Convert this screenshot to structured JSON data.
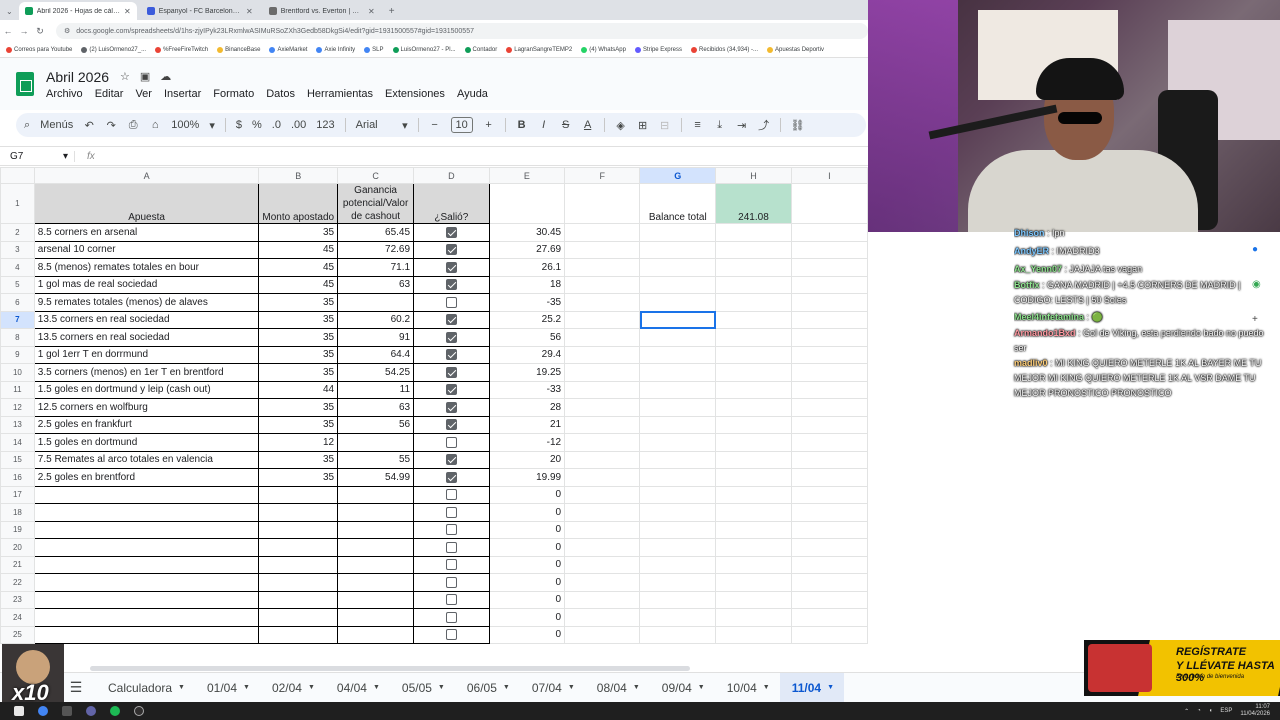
{
  "browser": {
    "tabs": [
      {
        "title": "Abril 2026 - Hojas de cálculo d",
        "active": true,
        "color": "#0f9d58"
      },
      {
        "title": "Espanyol - FC Barcelona en vivo",
        "active": false,
        "color": "#3b5bdb"
      },
      {
        "title": "Brentford vs. Everton | Disney+",
        "active": false,
        "color": "#6b6b6b"
      }
    ],
    "new_tab": "+",
    "url": "docs.google.com/spreadsheets/d/1hs-zjyIPyk23LRxmlwASIMuRSoZXh3Gedb58DkgSi4/edit?gid=1931500557#gid=1931500557",
    "bookmarks": [
      {
        "label": "Correos para Youtube",
        "color": "#ea4335"
      },
      {
        "label": "(2) LuisOrmeno27_...",
        "color": "#5f6368"
      },
      {
        "label": "%FreeFireTwitch",
        "color": "#ea4335"
      },
      {
        "label": "BinanceBase",
        "color": "#f3ba2f"
      },
      {
        "label": "AxieMarket",
        "color": "#4285f4"
      },
      {
        "label": "Axie Infinity",
        "color": "#4285f4"
      },
      {
        "label": "SLP",
        "color": "#4285f4"
      },
      {
        "label": "LuisOrmeno27 - Pl...",
        "color": "#0f9d58"
      },
      {
        "label": "Contador",
        "color": "#0f9d58"
      },
      {
        "label": "LagranSangreTEMP2",
        "color": "#ea4335"
      },
      {
        "label": "(4) WhatsApp",
        "color": "#25d366"
      },
      {
        "label": "Stripe Express",
        "color": "#635bff"
      },
      {
        "label": "Recibidos (34,934) -...",
        "color": "#ea4335"
      },
      {
        "label": "Apuestas Deportiv",
        "color": "#f3ba2f"
      }
    ]
  },
  "sheets_app": {
    "title": "Abril 2026",
    "menu": [
      "Archivo",
      "Editar",
      "Ver",
      "Insertar",
      "Formato",
      "Datos",
      "Herramientas",
      "Extensiones",
      "Ayuda"
    ],
    "toolbar": {
      "search": "Menús",
      "zoom": "100%",
      "currency": "$",
      "percent": "%",
      "dec_down": ".0",
      "dec_up": ".00",
      "format_123": "123",
      "font": "Arial",
      "font_size": "10"
    },
    "name_box": "G7",
    "fx": "fx"
  },
  "sheet": {
    "columns": [
      "A",
      "B",
      "C",
      "D",
      "E",
      "F",
      "G",
      "H",
      "I"
    ],
    "header_row": {
      "apuesta": "Apuesta",
      "monto": "Monto apostado",
      "ganancia": "Ganancia potencial/Valor de cashout",
      "salio": "¿Salió?",
      "balance_label": "Balance total",
      "balance_value": "241.08"
    },
    "rows": [
      {
        "n": "2",
        "apuesta": "8.5 corners en arsenal",
        "monto": "35",
        "ganancia": "65.45",
        "salio": true,
        "e": "30.45"
      },
      {
        "n": "3",
        "apuesta": "arsenal 10 corner",
        "monto": "45",
        "ganancia": "72.69",
        "salio": true,
        "e": "27.69"
      },
      {
        "n": "4",
        "apuesta": "8.5 (menos) remates totales en bour",
        "monto": "45",
        "ganancia": "71.1",
        "salio": true,
        "e": "26.1"
      },
      {
        "n": "5",
        "apuesta": "1 gol mas de real sociedad",
        "monto": "45",
        "ganancia": "63",
        "salio": true,
        "e": "18"
      },
      {
        "n": "6",
        "apuesta": "9.5 remates totales (menos) de alaves",
        "monto": "35",
        "ganancia": "",
        "salio": false,
        "e": "-35"
      },
      {
        "n": "7",
        "apuesta": "13.5 corners  en real sociedad",
        "monto": "35",
        "ganancia": "60.2",
        "salio": true,
        "e": "25.2"
      },
      {
        "n": "8",
        "apuesta": "13.5 corners  en real sociedad",
        "monto": "35",
        "ganancia": "91",
        "salio": true,
        "e": "56"
      },
      {
        "n": "9",
        "apuesta": "1 gol 1err T en dorrmund",
        "monto": "35",
        "ganancia": "64.4",
        "salio": true,
        "e": "29.4"
      },
      {
        "n": "10",
        "apuesta": "3.5 corners (menos) en 1er T en brentford",
        "monto": "35",
        "ganancia": "54.25",
        "salio": true,
        "e": "19.25"
      },
      {
        "n": "11",
        "apuesta": "1.5 goles en dortmund y leip (cash out)",
        "monto": "44",
        "ganancia": "11",
        "salio": true,
        "e": "-33"
      },
      {
        "n": "12",
        "apuesta": "12.5 corners en wolfburg",
        "monto": "35",
        "ganancia": "63",
        "salio": true,
        "e": "28"
      },
      {
        "n": "13",
        "apuesta": "2.5 goles en frankfurt",
        "monto": "35",
        "ganancia": "56",
        "salio": true,
        "e": "21"
      },
      {
        "n": "14",
        "apuesta": "1.5 goles en dortmund",
        "monto": "12",
        "ganancia": "",
        "salio": false,
        "e": "-12"
      },
      {
        "n": "15",
        "apuesta": "7.5 Remates al arco totales en valencia",
        "monto": "35",
        "ganancia": "55",
        "salio": true,
        "e": "20"
      },
      {
        "n": "16",
        "apuesta": "2.5 goles en brentford",
        "monto": "35",
        "ganancia": "54.99",
        "salio": true,
        "e": "19.99"
      },
      {
        "n": "17",
        "apuesta": "",
        "monto": "",
        "ganancia": "",
        "salio": false,
        "e": "0"
      },
      {
        "n": "18",
        "apuesta": "",
        "monto": "",
        "ganancia": "",
        "salio": false,
        "e": "0"
      },
      {
        "n": "19",
        "apuesta": "",
        "monto": "",
        "ganancia": "",
        "salio": false,
        "e": "0"
      },
      {
        "n": "20",
        "apuesta": "",
        "monto": "",
        "ganancia": "",
        "salio": false,
        "e": "0"
      },
      {
        "n": "21",
        "apuesta": "",
        "monto": "",
        "ganancia": "",
        "salio": false,
        "e": "0"
      },
      {
        "n": "22",
        "apuesta": "",
        "monto": "",
        "ganancia": "",
        "salio": false,
        "e": "0"
      },
      {
        "n": "23",
        "apuesta": "",
        "monto": "",
        "ganancia": "",
        "salio": false,
        "e": "0"
      },
      {
        "n": "24",
        "apuesta": "",
        "monto": "",
        "ganancia": "",
        "salio": false,
        "e": "0"
      },
      {
        "n": "25",
        "apuesta": "",
        "monto": "",
        "ganancia": "",
        "salio": false,
        "e": "0"
      }
    ]
  },
  "sheet_tabs": [
    "Calculadora",
    "01/04",
    "02/04",
    "04/04",
    "05/05",
    "06/05",
    "07/04",
    "08/04",
    "09/04",
    "10/04",
    "11/04"
  ],
  "active_sheet_tab": "11/04",
  "chat": [
    {
      "user": "Dhison",
      "color": "#7ec8ff",
      "msg": "Ipn"
    },
    {
      "user": "AndyER",
      "color": "#7ec8ff",
      "msg": "IMADRID3"
    },
    {
      "user": "Ax_Yenn07",
      "color": "#8fe38f",
      "msg": "JAJAJA tas vagan"
    },
    {
      "user": "Botfix",
      "color": "#8fe38f",
      "msg": "GANA MADRID | +4.5 CORNERS DE MADRID | CODIGO: LESTS | 50 Soles"
    },
    {
      "user": "Meel4infetamina",
      "color": "#8fe38f",
      "msg": "🟢"
    },
    {
      "user": "Armando1Bxd",
      "color": "#ff9aa2",
      "msg": "Gol de Viking, esta perdiendo bado no puedo ser"
    },
    {
      "user": "madliv0",
      "color": "#ffcf7a",
      "msg": "MI KING QUIERO METERLE 1K AL BAYER ME TU MEJOR MI KING QUIERO METERLE 1K AL VSR DAME TU MEJOR PRONOSTICO PRONOSTICO"
    }
  ],
  "ad": {
    "line1": "REGÍSTRATE",
    "line2": "Y LLÉVATE HASTA 300%",
    "line3": "En tu bono de bienvenida"
  },
  "emote": {
    "label": "x10"
  },
  "taskbar": {
    "lang": "ESP",
    "time": "11:07",
    "date": "11/04/2026"
  }
}
